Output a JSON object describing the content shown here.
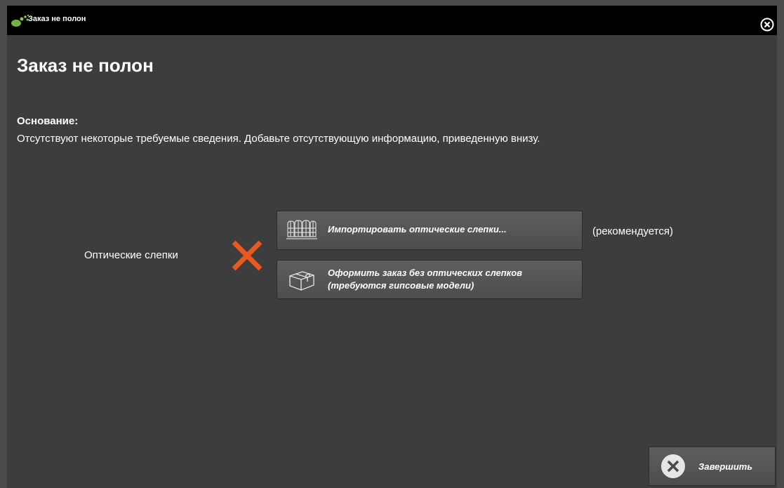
{
  "window": {
    "title": "Заказ не полон"
  },
  "main": {
    "heading": "Заказ не полон",
    "reason_label": "Основание:",
    "reason_text": "Отсутствуют некоторые требуемые сведения. Добавьте отсутствующую информацию, приведенную внизу.",
    "section_label": "Оптические слепки",
    "status_icon": "x-mark-icon",
    "import_button": {
      "label": "Импортировать оптические слепки...",
      "icon": "teeth-scan-icon"
    },
    "recommended_text": "(рекомендуется)",
    "no_scans_button": {
      "label_line1": "Оформить заказ без оптических слепков",
      "label_line2": "(требуются гипсовые модели)",
      "icon": "box-icon"
    }
  },
  "footer": {
    "finish_button": {
      "label": "Завершить",
      "icon": "close-circle-icon"
    }
  },
  "colors": {
    "background": "#3d3d3d",
    "titlebar": "#000000",
    "x_mark": "#e8581f",
    "text": "#ffffff"
  }
}
